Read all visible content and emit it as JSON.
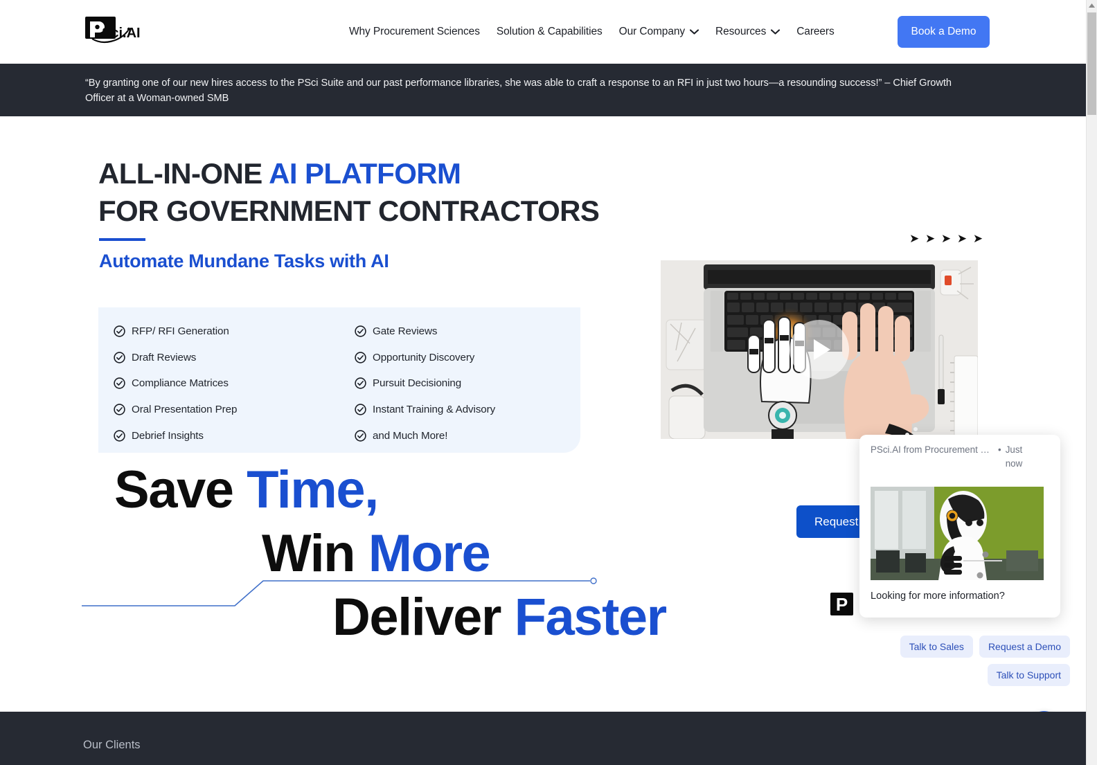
{
  "header": {
    "logo_alt": "PSci.AI",
    "nav": [
      {
        "label": "Why Procurement Sciences",
        "has_chevron": false
      },
      {
        "label": "Solution & Capabilities",
        "has_chevron": false
      },
      {
        "label": "Our Company",
        "has_chevron": true
      },
      {
        "label": "Resources",
        "has_chevron": true
      },
      {
        "label": "Careers",
        "has_chevron": false
      }
    ],
    "cta_label": "Book a Demo"
  },
  "banner": {
    "quote": "“By granting one of our new hires access to the PSci Suite and our past performance libraries, she was able to craft a response to an RFI in just two hours—a resounding success!” – Chief Growth Officer at a Woman-owned SMB"
  },
  "hero": {
    "title_line1_plain": "ALL-IN-ONE ",
    "title_line1_accent": "AI PLATFORM",
    "title_line2": "FOR GOVERNMENT CONTRACTORS",
    "subtitle": "Automate Mundane Tasks with AI",
    "features_left": [
      "RFP/ RFI Generation",
      "Draft Reviews",
      "Compliance Matrices",
      "Oral Presentation Prep",
      "Debrief Insights"
    ],
    "features_right": [
      "Gate Reviews",
      "Opportunity Discovery",
      "Pursuit Decisioning",
      "Instant Training & Advisory",
      "and Much More!"
    ],
    "tagline": {
      "line1_plain": "Save ",
      "line1_accent": "Time,",
      "line2_plain": "Win ",
      "line2_accent": "More",
      "line3_plain": "Deliver ",
      "line3_accent": "Faster"
    },
    "arrows": "➤ ➤ ➤ ➤ ➤",
    "request_button": "Request",
    "p_badge": "P"
  },
  "chat": {
    "sender": "PSci.AI from Procurement S...",
    "separator": "•",
    "time": "Just now",
    "message": "Looking for more information?",
    "quick_replies": [
      "Talk to Sales",
      "Request a Demo",
      "Talk to Support"
    ]
  },
  "clients": {
    "title": "Our Clients"
  },
  "colors": {
    "brand_blue": "#1a4fd0",
    "button_blue": "#4277f3",
    "request_blue": "#0d50c9",
    "dark_bg": "#262a33",
    "feature_bg": "#eff5fd",
    "quick_reply_bg": "#e9eefc"
  }
}
